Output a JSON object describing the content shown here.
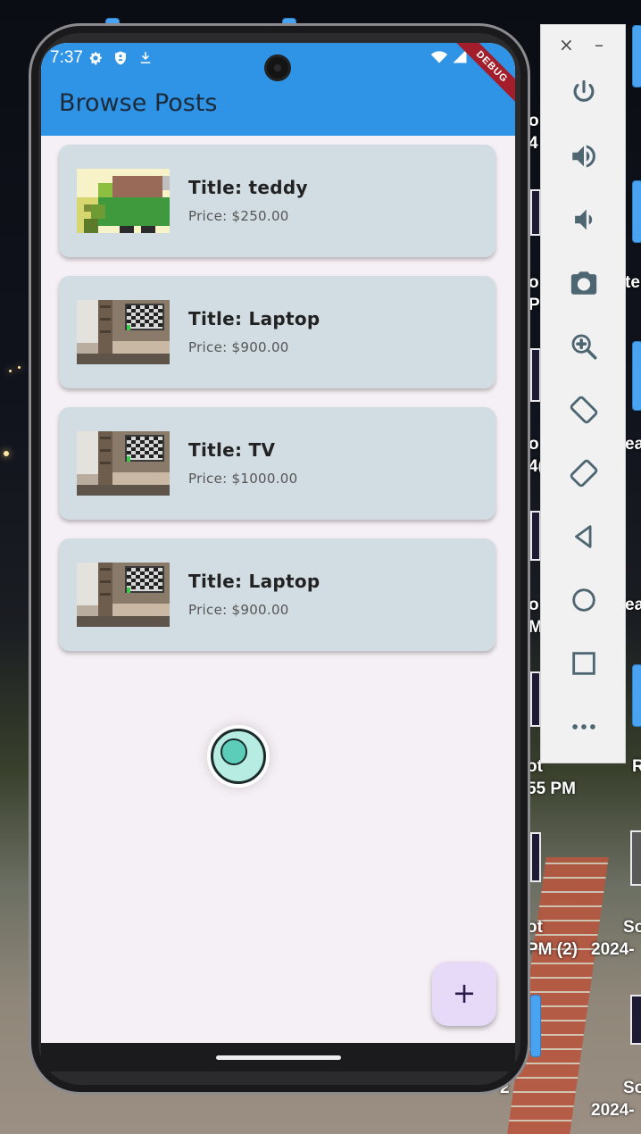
{
  "desktop": {
    "labels": [
      {
        "text": "o"
      },
      {
        "text": "4"
      },
      {
        "text": "o"
      },
      {
        "text": "PM"
      },
      {
        "text": "te"
      },
      {
        "text": "o"
      },
      {
        "text": "4("
      },
      {
        "text": "ea"
      },
      {
        "text": "o"
      },
      {
        "text": "M"
      },
      {
        "text": "ea"
      },
      {
        "text": "ot"
      },
      {
        "text": "55 PM"
      },
      {
        "text": "R"
      },
      {
        "text": "ot"
      },
      {
        "text": "PM (2)"
      },
      {
        "text": "So"
      },
      {
        "text": "2024-"
      },
      {
        "text": "So"
      },
      {
        "text": "2024-"
      },
      {
        "text": "2"
      }
    ]
  },
  "status_bar": {
    "time": "7:37",
    "icons": [
      "settings-icon",
      "shield-icon",
      "download-icon",
      "wifi-icon",
      "signal-icon"
    ],
    "debug_banner": "DEBUG"
  },
  "app_bar": {
    "title": "Browse Posts"
  },
  "posts": [
    {
      "title": "Title: teddy",
      "price": "Price: $250.00",
      "image": "pixel-art-teddy"
    },
    {
      "title": "Title: Laptop",
      "price": "Price: $900.00",
      "image": "room-tv-photo"
    },
    {
      "title": "Title: TV",
      "price": "Price: $1000.00",
      "image": "room-tv-photo"
    },
    {
      "title": "Title: Laptop",
      "price": "Price: $900.00",
      "image": "room-tv-photo"
    }
  ],
  "fab": {
    "label": "+",
    "icon": "add-icon"
  },
  "emulator_toolbar": {
    "close": "×",
    "minimize": "–",
    "buttons": [
      "power-icon",
      "volume-up-icon",
      "volume-down-icon",
      "camera-icon",
      "zoom-icon",
      "rotate-left-icon",
      "rotate-right-icon",
      "back-icon",
      "home-icon",
      "overview-icon",
      "more-icon"
    ]
  },
  "colors": {
    "app_bar": "#2f93e6",
    "card": "#d2dde3",
    "screen_bg": "#f5f0f5",
    "fab": "#e6daf8",
    "debug": "#a41d2a"
  }
}
